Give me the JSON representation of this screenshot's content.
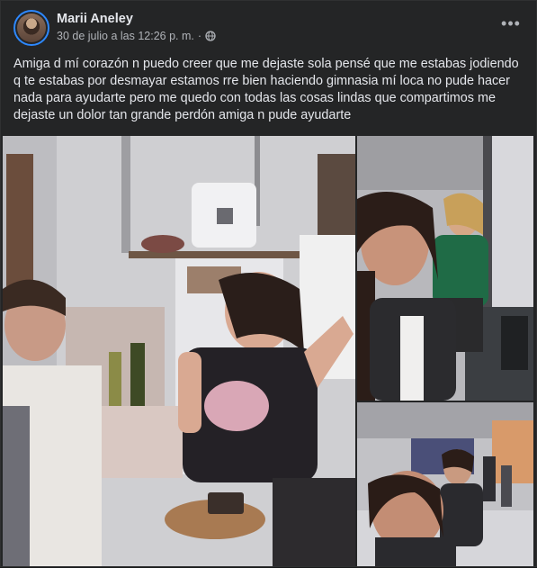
{
  "post": {
    "author": "Marii Aneley",
    "timestamp": "30 de julio a las 12:26 p. m.",
    "separator": "·",
    "privacy_icon": "globe-icon",
    "more_icon": "more-horizontal-icon",
    "more_label": "•••",
    "text": "Amiga d mí corazón n puedo creer que me dejaste sola pensé que me estabas jodiendo q te estabas por desmayar estamos rre bien haciendo gimnasia mí loca no pude hacer nada para ayudarte pero me quedo con todas las cosas lindas que compartimos me dejaste un dolor tan grande perdón amiga n pude ayudarte"
  },
  "photos": [
    {
      "subject": "kitchen-singing-photo"
    },
    {
      "subject": "gym-selfie-photo"
    },
    {
      "subject": "gym-selfie-photo-2"
    }
  ],
  "colors": {
    "background": "#242526",
    "text": "#e4e6eb",
    "secondary_text": "#b0b3b8",
    "accent": "#2d88ff"
  }
}
